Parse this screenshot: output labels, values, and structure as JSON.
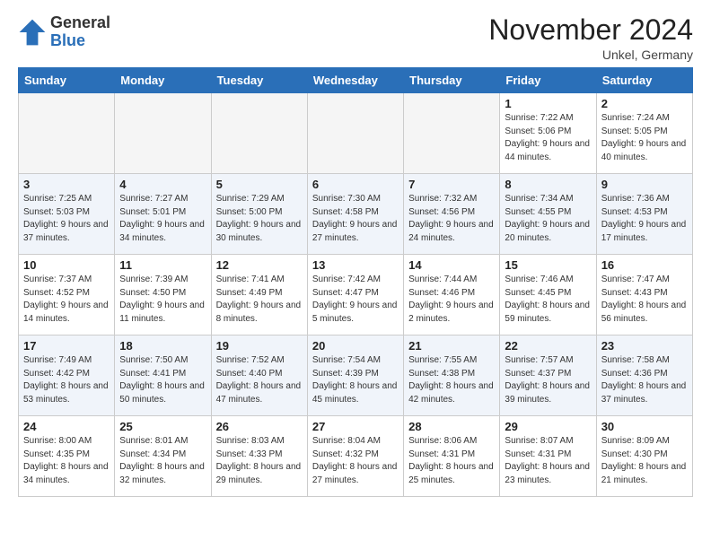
{
  "logo": {
    "general": "General",
    "blue": "Blue"
  },
  "title": "November 2024",
  "subtitle": "Unkel, Germany",
  "days_of_week": [
    "Sunday",
    "Monday",
    "Tuesday",
    "Wednesday",
    "Thursday",
    "Friday",
    "Saturday"
  ],
  "weeks": [
    [
      {
        "day": "",
        "info": ""
      },
      {
        "day": "",
        "info": ""
      },
      {
        "day": "",
        "info": ""
      },
      {
        "day": "",
        "info": ""
      },
      {
        "day": "",
        "info": ""
      },
      {
        "day": "1",
        "info": "Sunrise: 7:22 AM\nSunset: 5:06 PM\nDaylight: 9 hours\nand 44 minutes."
      },
      {
        "day": "2",
        "info": "Sunrise: 7:24 AM\nSunset: 5:05 PM\nDaylight: 9 hours\nand 40 minutes."
      }
    ],
    [
      {
        "day": "3",
        "info": "Sunrise: 7:25 AM\nSunset: 5:03 PM\nDaylight: 9 hours\nand 37 minutes."
      },
      {
        "day": "4",
        "info": "Sunrise: 7:27 AM\nSunset: 5:01 PM\nDaylight: 9 hours\nand 34 minutes."
      },
      {
        "day": "5",
        "info": "Sunrise: 7:29 AM\nSunset: 5:00 PM\nDaylight: 9 hours\nand 30 minutes."
      },
      {
        "day": "6",
        "info": "Sunrise: 7:30 AM\nSunset: 4:58 PM\nDaylight: 9 hours\nand 27 minutes."
      },
      {
        "day": "7",
        "info": "Sunrise: 7:32 AM\nSunset: 4:56 PM\nDaylight: 9 hours\nand 24 minutes."
      },
      {
        "day": "8",
        "info": "Sunrise: 7:34 AM\nSunset: 4:55 PM\nDaylight: 9 hours\nand 20 minutes."
      },
      {
        "day": "9",
        "info": "Sunrise: 7:36 AM\nSunset: 4:53 PM\nDaylight: 9 hours\nand 17 minutes."
      }
    ],
    [
      {
        "day": "10",
        "info": "Sunrise: 7:37 AM\nSunset: 4:52 PM\nDaylight: 9 hours\nand 14 minutes."
      },
      {
        "day": "11",
        "info": "Sunrise: 7:39 AM\nSunset: 4:50 PM\nDaylight: 9 hours\nand 11 minutes."
      },
      {
        "day": "12",
        "info": "Sunrise: 7:41 AM\nSunset: 4:49 PM\nDaylight: 9 hours\nand 8 minutes."
      },
      {
        "day": "13",
        "info": "Sunrise: 7:42 AM\nSunset: 4:47 PM\nDaylight: 9 hours\nand 5 minutes."
      },
      {
        "day": "14",
        "info": "Sunrise: 7:44 AM\nSunset: 4:46 PM\nDaylight: 9 hours\nand 2 minutes."
      },
      {
        "day": "15",
        "info": "Sunrise: 7:46 AM\nSunset: 4:45 PM\nDaylight: 8 hours\nand 59 minutes."
      },
      {
        "day": "16",
        "info": "Sunrise: 7:47 AM\nSunset: 4:43 PM\nDaylight: 8 hours\nand 56 minutes."
      }
    ],
    [
      {
        "day": "17",
        "info": "Sunrise: 7:49 AM\nSunset: 4:42 PM\nDaylight: 8 hours\nand 53 minutes."
      },
      {
        "day": "18",
        "info": "Sunrise: 7:50 AM\nSunset: 4:41 PM\nDaylight: 8 hours\nand 50 minutes."
      },
      {
        "day": "19",
        "info": "Sunrise: 7:52 AM\nSunset: 4:40 PM\nDaylight: 8 hours\nand 47 minutes."
      },
      {
        "day": "20",
        "info": "Sunrise: 7:54 AM\nSunset: 4:39 PM\nDaylight: 8 hours\nand 45 minutes."
      },
      {
        "day": "21",
        "info": "Sunrise: 7:55 AM\nSunset: 4:38 PM\nDaylight: 8 hours\nand 42 minutes."
      },
      {
        "day": "22",
        "info": "Sunrise: 7:57 AM\nSunset: 4:37 PM\nDaylight: 8 hours\nand 39 minutes."
      },
      {
        "day": "23",
        "info": "Sunrise: 7:58 AM\nSunset: 4:36 PM\nDaylight: 8 hours\nand 37 minutes."
      }
    ],
    [
      {
        "day": "24",
        "info": "Sunrise: 8:00 AM\nSunset: 4:35 PM\nDaylight: 8 hours\nand 34 minutes."
      },
      {
        "day": "25",
        "info": "Sunrise: 8:01 AM\nSunset: 4:34 PM\nDaylight: 8 hours\nand 32 minutes."
      },
      {
        "day": "26",
        "info": "Sunrise: 8:03 AM\nSunset: 4:33 PM\nDaylight: 8 hours\nand 29 minutes."
      },
      {
        "day": "27",
        "info": "Sunrise: 8:04 AM\nSunset: 4:32 PM\nDaylight: 8 hours\nand 27 minutes."
      },
      {
        "day": "28",
        "info": "Sunrise: 8:06 AM\nSunset: 4:31 PM\nDaylight: 8 hours\nand 25 minutes."
      },
      {
        "day": "29",
        "info": "Sunrise: 8:07 AM\nSunset: 4:31 PM\nDaylight: 8 hours\nand 23 minutes."
      },
      {
        "day": "30",
        "info": "Sunrise: 8:09 AM\nSunset: 4:30 PM\nDaylight: 8 hours\nand 21 minutes."
      }
    ]
  ]
}
